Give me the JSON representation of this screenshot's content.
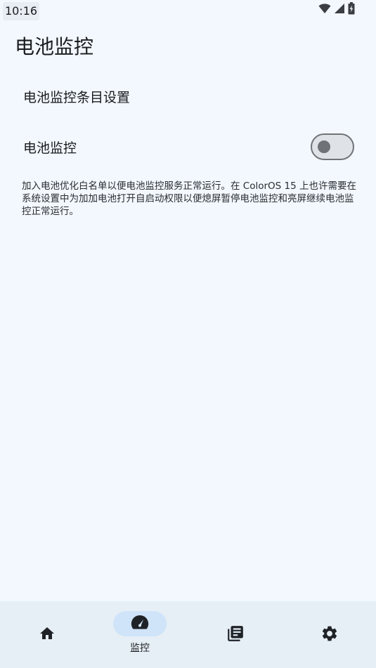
{
  "status_bar": {
    "time": "10:16",
    "icons": [
      "wifi-icon",
      "cellular-signal-icon",
      "battery-charging-icon"
    ]
  },
  "page": {
    "title": "电池监控"
  },
  "settings": {
    "items": [
      {
        "label": "电池监控条目设置"
      },
      {
        "label": "电池监控",
        "toggle_on": false
      }
    ],
    "description": "加入电池优化白名单以便电池监控服务正常运行。在 ColorOS 15 上也许需要在系统设置中为加加电池打开自启动权限以便熄屏暂停电池监控和亮屏继续电池监控正常运行。"
  },
  "bottom_nav": {
    "items": [
      {
        "icon": "home-icon",
        "label": ""
      },
      {
        "icon": "speedometer-icon",
        "label": "监控",
        "selected": true
      },
      {
        "icon": "log-icon",
        "label": ""
      },
      {
        "icon": "gear-icon",
        "label": ""
      }
    ]
  },
  "colors": {
    "background": "#f2f8fe",
    "nav_background": "#e6eef6",
    "nav_selected_pill": "#cfe4f8",
    "toggle_outline": "#6f7378"
  }
}
